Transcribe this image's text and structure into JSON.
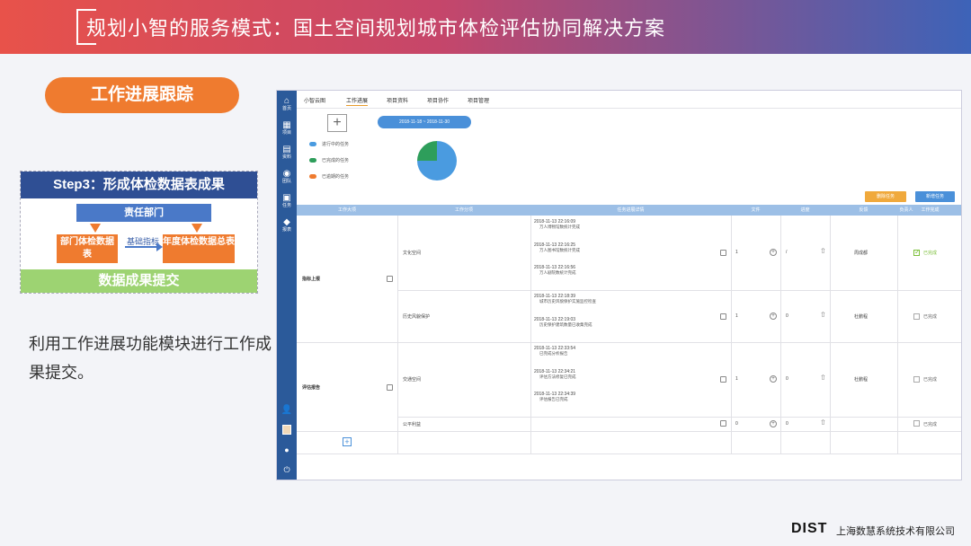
{
  "slide": {
    "title": "规划小智的服务模式：国土空间规划城市体检评估协同解决方案",
    "section_pill": "工作进展跟踪",
    "description": "利用工作进展功能模块进行工作成果提交。",
    "company_logo": "DIST",
    "company_name": "上海数慧系统技术有限公司"
  },
  "diagram": {
    "header": "Step3：形成体检数据表成果",
    "top_box": "责任部门",
    "left_box": "部门体检数据表",
    "right_box": "年度体检数据总表",
    "middle_label": "基础指标",
    "bottom_bar": "数据成果提交"
  },
  "app": {
    "rail": [
      {
        "icon": "⌂",
        "label": "首页"
      },
      {
        "icon": "▦",
        "label": "项目"
      },
      {
        "icon": "▤",
        "label": "资料"
      },
      {
        "icon": "◉",
        "label": "团队"
      },
      {
        "icon": "▣",
        "label": "任务"
      },
      {
        "icon": "◆",
        "label": "报表"
      }
    ],
    "tabs": [
      "小智云图",
      "工作进展",
      "项目资料",
      "项目协作",
      "项目管理"
    ],
    "active_tab": "工作进展",
    "date_range": "2018-11-18 ~ 2018-11-30",
    "legend": [
      {
        "label": "进行中的任务",
        "color": "#4a9be0"
      },
      {
        "label": "已完成的任务",
        "color": "#2e9e5b"
      },
      {
        "label": "已逾期的任务",
        "color": "#ef7b2f"
      }
    ],
    "pie": [
      {
        "name": "进行中的任务",
        "value": 75,
        "color": "#4a9be0"
      },
      {
        "name": "已完成的任务",
        "value": 25,
        "color": "#2e9e5b"
      }
    ],
    "buttons": {
      "orange": "删除任务",
      "blue": "新增任务"
    },
    "columns": [
      "工作大项",
      "工作分项",
      "任务进展详情",
      "文件",
      "进度",
      "反馈",
      "负责人",
      "工作完成"
    ],
    "rows": [
      {
        "group": "指标上报",
        "sub": "文化空间",
        "entries": [
          {
            "time": "2018-11-13 22:16:09",
            "desc": "万人博物馆数统计完成"
          },
          {
            "time": "2018-11-13 22:16:25",
            "desc": "万人图书馆数统计完成"
          },
          {
            "time": "2018-11-13 22:16:56",
            "desc": "万人剧院数统计完成"
          }
        ],
        "file": "1",
        "progress": "/",
        "owner": "周成都",
        "done": true
      },
      {
        "sub": "历史风貌保护",
        "entries": [
          {
            "time": "2018-11-13 22:18:39",
            "desc": "城市历史风貌保护实施监控检查"
          },
          {
            "time": "2018-11-13 22:19:03",
            "desc": "历史保护建筑数量已收集完成"
          }
        ],
        "file": "1",
        "progress": "0",
        "owner": "杜鹏程",
        "done": false
      },
      {
        "group": "评估报告",
        "sub": "交通空间",
        "entries": [
          {
            "time": "2018-11-13 22:33:54",
            "desc": "已完成分析报告"
          },
          {
            "time": "2018-11-13 22:34:21",
            "desc": "评估方法修复已完成"
          },
          {
            "time": "2018-11-13 22:34:39",
            "desc": "评估报告已完成"
          }
        ],
        "file": "1",
        "progress": "0",
        "owner": "杜鹏程",
        "done": false
      },
      {
        "sub": "公平利益",
        "entries": [],
        "file": "0",
        "progress": "0",
        "owner": "",
        "done": false
      }
    ],
    "done_label": "已完成"
  }
}
